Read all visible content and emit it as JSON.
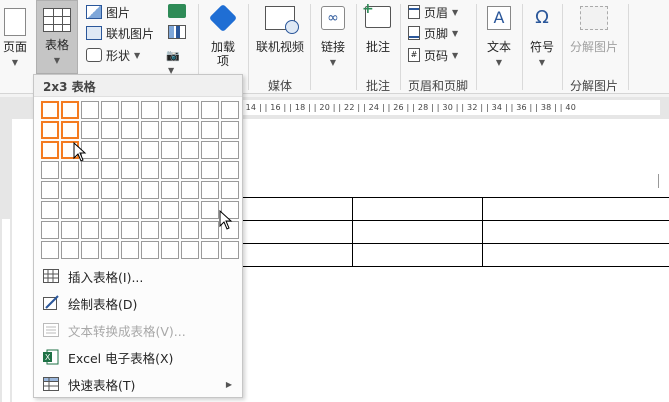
{
  "ribbon": {
    "page_label": "页面",
    "table_label": "表格",
    "picture_label": "图片",
    "online_picture_label": "联机图片",
    "shapes_label": "形状",
    "addins_label_1": "加载",
    "addins_label_2": "项",
    "online_video_label": "联机视频",
    "link_label": "链接",
    "comment_label": "批注",
    "header_label": "页眉",
    "footer_label": "页脚",
    "page_number_label": "页码",
    "text_label": "文本",
    "symbol_label": "符号",
    "ungroup_picture_label": "分解图片",
    "group_media": "媒体",
    "group_comments": "批注",
    "group_header_footer": "页眉和页脚",
    "group_ungroup": "分解图片"
  },
  "ruler": {
    "ticks": "| 14 |  | 16 |  | 18 |  | 20 |  | 22 |  | 24 |  | 26 |  | 28 |  | 30 |  | 32 |  | 34 |  | 36 |  | 38 |  | 40"
  },
  "menu": {
    "title": "2x3 表格",
    "grid_rows": 8,
    "grid_cols": 10,
    "selected_rows": 3,
    "selected_cols": 2,
    "items": [
      {
        "label": "插入表格(I)...",
        "icon": "insert-table-icon",
        "enabled": true
      },
      {
        "label": "绘制表格(D)",
        "icon": "draw-table-icon",
        "enabled": true
      },
      {
        "label": "文本转换成表格(V)...",
        "icon": "convert-text-icon",
        "enabled": false
      },
      {
        "label": "Excel 电子表格(X)",
        "icon": "excel-icon",
        "enabled": true
      },
      {
        "label": "快速表格(T)",
        "icon": "quick-table-icon",
        "enabled": true,
        "submenu": true
      }
    ]
  },
  "colors": {
    "selection": "#f47b20",
    "ribbon_bg": "#f8f8f8",
    "accent_blue": "#2b579a"
  }
}
